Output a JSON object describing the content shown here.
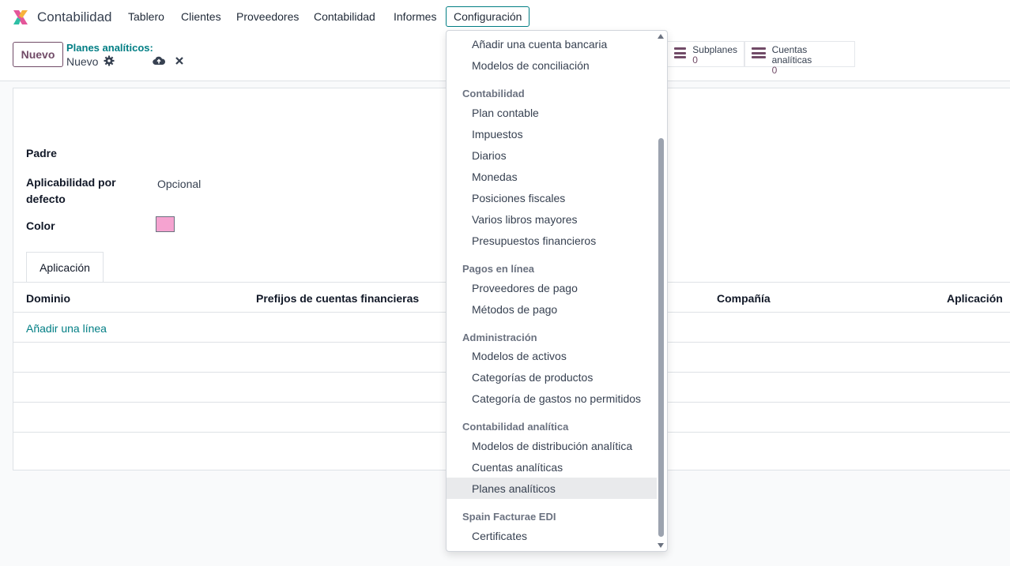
{
  "app": {
    "name": "Contabilidad"
  },
  "nav": {
    "items": [
      "Tablero",
      "Clientes",
      "Proveedores",
      "Contabilidad",
      "Informes",
      "Configuración"
    ]
  },
  "control": {
    "new_label": "Nuevo",
    "breadcrumb_parent": "Planes analíticos:",
    "breadcrumb_current": "Nuevo",
    "stats": [
      {
        "label": "Subplanes",
        "value": "0"
      },
      {
        "label": "Cuentas analíticas",
        "value": "0"
      }
    ]
  },
  "form": {
    "parent_label": "Padre",
    "applicability_label": "Aplicabilidad por defecto",
    "applicability_value": "Opcional",
    "color_label": "Color",
    "color_value": "#f5a3d0",
    "tab_label": "Aplicación",
    "columns": [
      "Dominio",
      "Prefijos de cuentas financieras",
      "Compañía",
      "Aplicación"
    ],
    "add_line": "Añadir una línea"
  },
  "dropdown": {
    "items_top": [
      "Añadir una cuenta bancaria",
      "Modelos de conciliación"
    ],
    "sections": [
      {
        "header": "Contabilidad",
        "items": [
          "Plan contable",
          "Impuestos",
          "Diarios",
          "Monedas",
          "Posiciones fiscales",
          "Varios libros mayores",
          "Presupuestos financieros"
        ]
      },
      {
        "header": "Pagos en línea",
        "items": [
          "Proveedores de pago",
          "Métodos de pago"
        ]
      },
      {
        "header": "Administración",
        "items": [
          "Modelos de activos",
          "Categorías de productos",
          "Categoría de gastos no permitidos"
        ]
      },
      {
        "header": "Contabilidad analítica",
        "items": [
          "Modelos de distribución analítica",
          "Cuentas analíticas",
          "Planes analíticos"
        ]
      },
      {
        "header": "Spain Facturae EDI",
        "items": [
          "Certificates"
        ]
      }
    ],
    "selected": "Planes analíticos"
  },
  "colors": {
    "accent": "#017e84",
    "brand": "#714b67"
  }
}
